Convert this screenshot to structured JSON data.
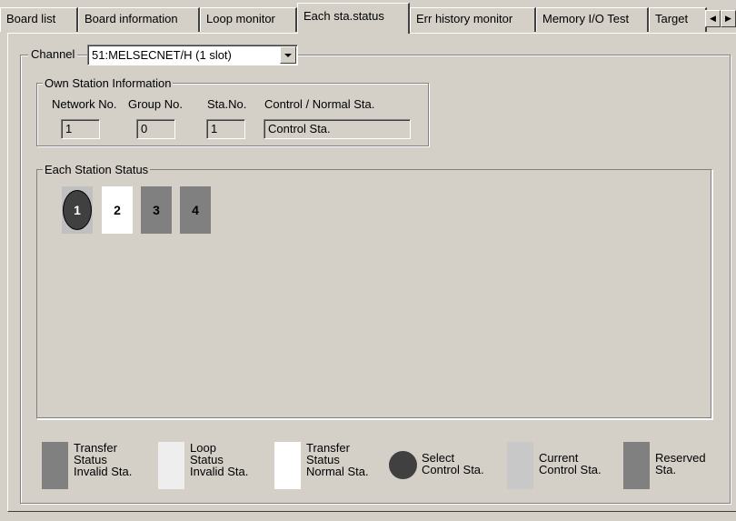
{
  "tabs": [
    {
      "label": "Board list",
      "active": false
    },
    {
      "label": "Board information",
      "active": false
    },
    {
      "label": "Loop monitor",
      "active": false
    },
    {
      "label": "Each sta.status",
      "active": true
    },
    {
      "label": "Err history monitor",
      "active": false
    },
    {
      "label": "Memory I/O Test",
      "active": false
    },
    {
      "label": "Target",
      "active": false
    }
  ],
  "channel": {
    "label": "Channel",
    "selected": "51:MELSECNET/H (1 slot)"
  },
  "own_station": {
    "title": "Own Station Information",
    "network_no_label": "Network No.",
    "group_no_label": "Group No.",
    "sta_no_label": "Sta.No.",
    "control_label": "Control / Normal Sta.",
    "network_no": "1",
    "group_no": "0",
    "sta_no": "1",
    "control": "Control Sta."
  },
  "each_station": {
    "title": "Each Station Status",
    "stations": [
      {
        "no": "1",
        "status": "current-control"
      },
      {
        "no": "2",
        "status": "transfer-normal"
      },
      {
        "no": "3",
        "status": "transfer-invalid"
      },
      {
        "no": "4",
        "status": "transfer-invalid"
      }
    ]
  },
  "legend": {
    "transfer_invalid": "Transfer\nStatus\nInvalid Sta.",
    "loop_invalid": "Loop\nStatus\nInvalid Sta.",
    "transfer_normal": "Transfer\nStatus\nNormal Sta.",
    "select_control": "Select\nControl Sta.",
    "current_control": "Current\nControl Sta.",
    "reserved": "Reserved\nSta."
  },
  "colors": {
    "face": "#d4d0c8",
    "transfer_invalid": "#808080",
    "loop_invalid": "#eeeeee",
    "transfer_normal": "#ffffff",
    "select_control": "#404040",
    "current_control": "#c8c8c8",
    "reserved": "#808080"
  }
}
